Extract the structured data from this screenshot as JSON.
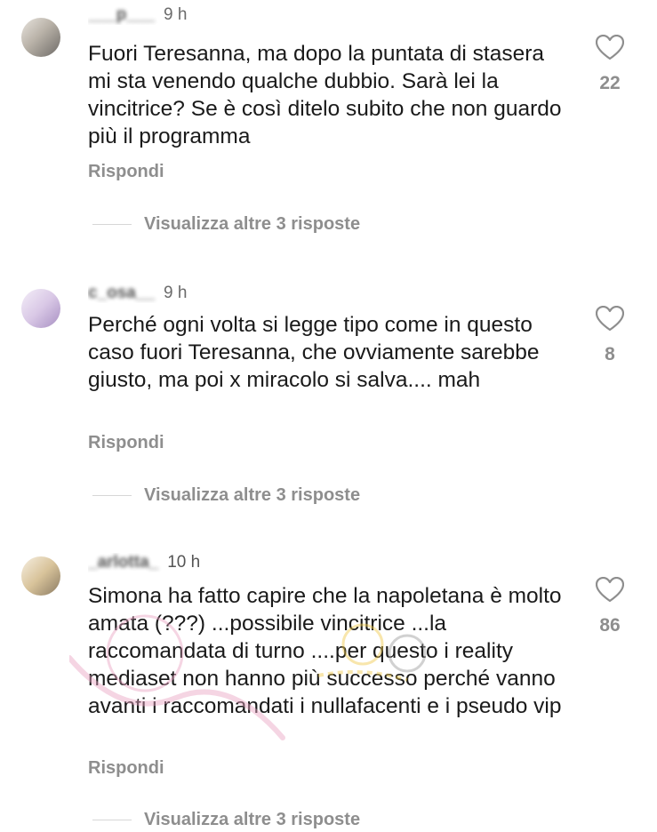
{
  "comments": [
    {
      "username": "___p___",
      "time": "9 h",
      "text": "Fuori Teresanna, ma dopo la puntata di stasera mi sta venendo qualche dubbio. Sarà lei la vincitrice? Se è così ditelo subito che non guardo più il programma",
      "reply_label": "Rispondi",
      "more_replies": "Visualizza altre 3 risposte",
      "likes": "22"
    },
    {
      "username": "c_osa__",
      "time": "9 h",
      "text": "Perché ogni volta si legge tipo come in questo caso fuori Teresanna, che ovviamente sarebbe giusto, ma poi x miracolo si salva.... mah",
      "reply_label": "Rispondi",
      "more_replies": "Visualizza altre 3 risposte",
      "likes": "8"
    },
    {
      "username": "_arlotta_",
      "time": "10 h",
      "text": "Simona ha fatto capire che la napoletana è molto amata (???) ...possibile vincitrice ...la raccomandata di turno ....per questo i reality mediaset non hanno più successo perché vanno avanti i raccomandati i nullafacenti e i pseudo vip",
      "reply_label": "Rispondi",
      "more_replies": "Visualizza altre 3 risposte",
      "likes": "86"
    }
  ],
  "icons": {
    "like": "heart-outline-icon"
  },
  "colors": {
    "text": "#1a1a1a",
    "secondary": "#8e8e8e",
    "background": "#ffffff"
  }
}
